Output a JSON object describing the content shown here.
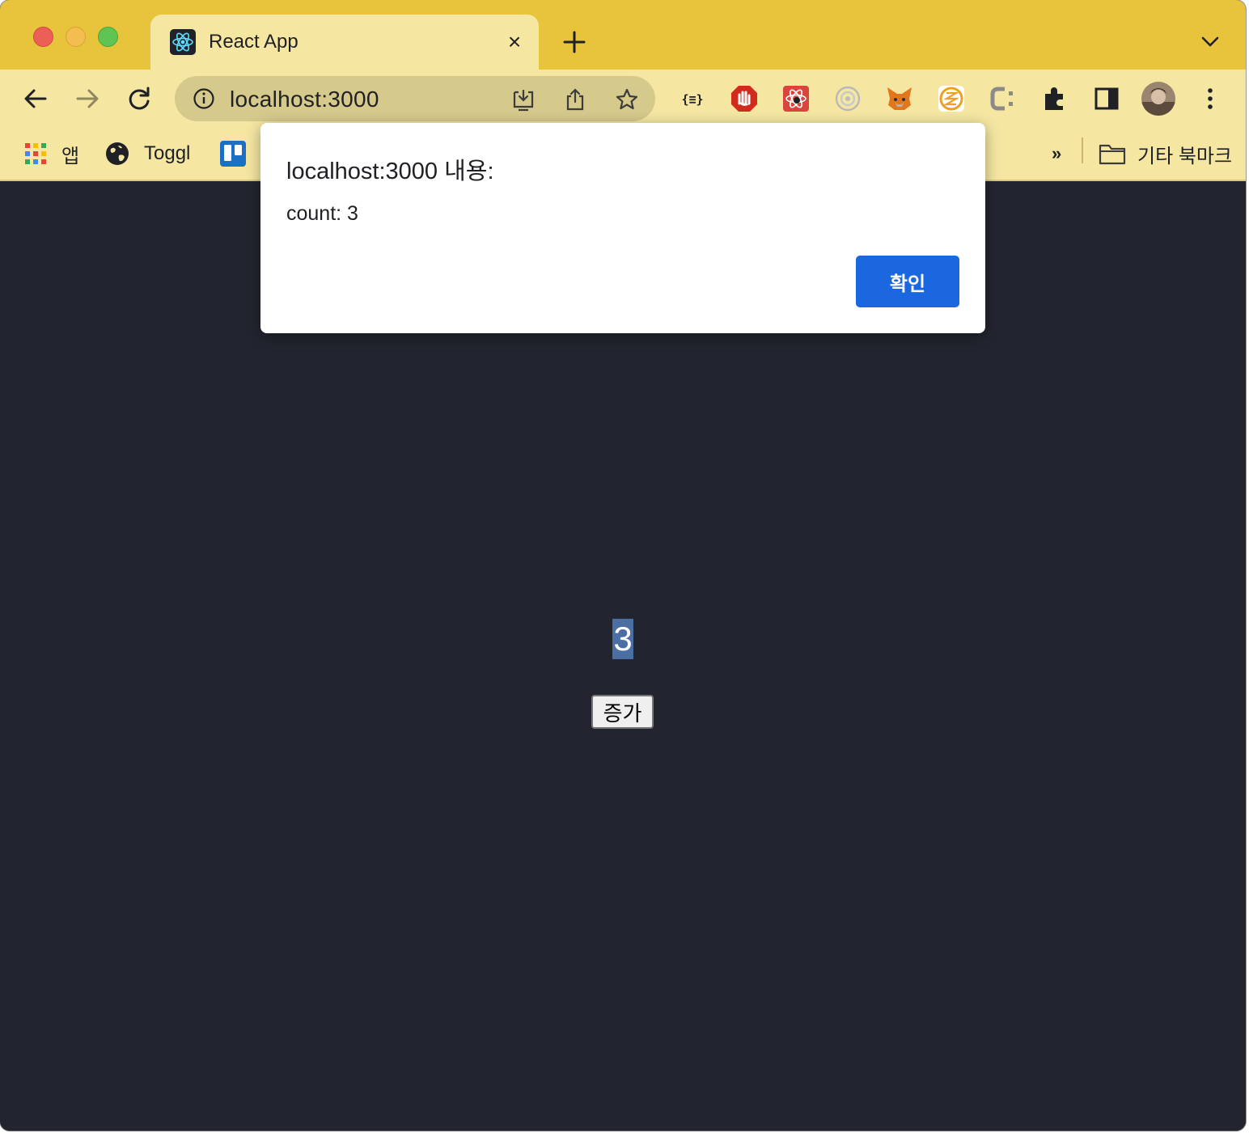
{
  "tab": {
    "title": "React App",
    "close": "×"
  },
  "toolbar": {
    "url": "localhost:3000"
  },
  "bookmarks": {
    "apps": "앱",
    "toggl": "Toggl",
    "more": "»",
    "other": "기타 북마크"
  },
  "alert": {
    "title": "localhost:3000 내용:",
    "message": "count: 3",
    "ok": "확인"
  },
  "app": {
    "count": "3",
    "increment": "증가"
  },
  "colors": {
    "tabstrip": "#e8c43c",
    "toolbar": "#f5e7a2",
    "page_bg": "#22252f",
    "dialog_button": "#1a67e0",
    "count_highlight": "#4b6ea3"
  }
}
